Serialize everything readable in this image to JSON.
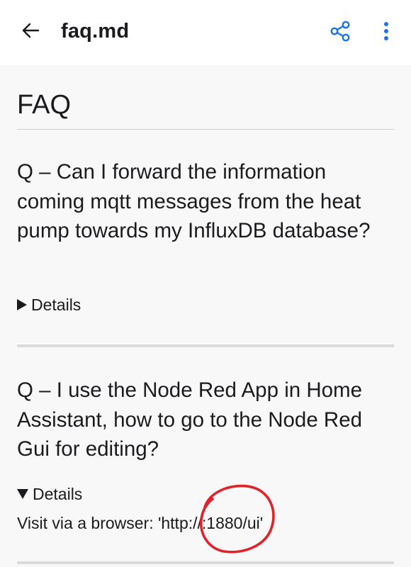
{
  "app_bar": {
    "back_icon": "arrow-left-icon",
    "title": "faq.md",
    "share_icon": "share-icon",
    "more_icon": "more-vert-icon",
    "accent_color": "#1a73e8"
  },
  "document": {
    "heading": "FAQ",
    "items": [
      {
        "question": "Q – Can I forward the information coming mqtt messages from the heat pump towards my InfluxDB database?",
        "summary": "Details",
        "expanded": false
      },
      {
        "question": "Q – I use the Node Red App in Home Assistant, how to go to the Node Red Gui for editing?",
        "summary": "Details",
        "expanded": true,
        "body": "Visit via a browser: 'http://:1880/ui'"
      }
    ]
  },
  "annotation": {
    "shape": "hand-drawn circle",
    "color": "#e0222a"
  }
}
